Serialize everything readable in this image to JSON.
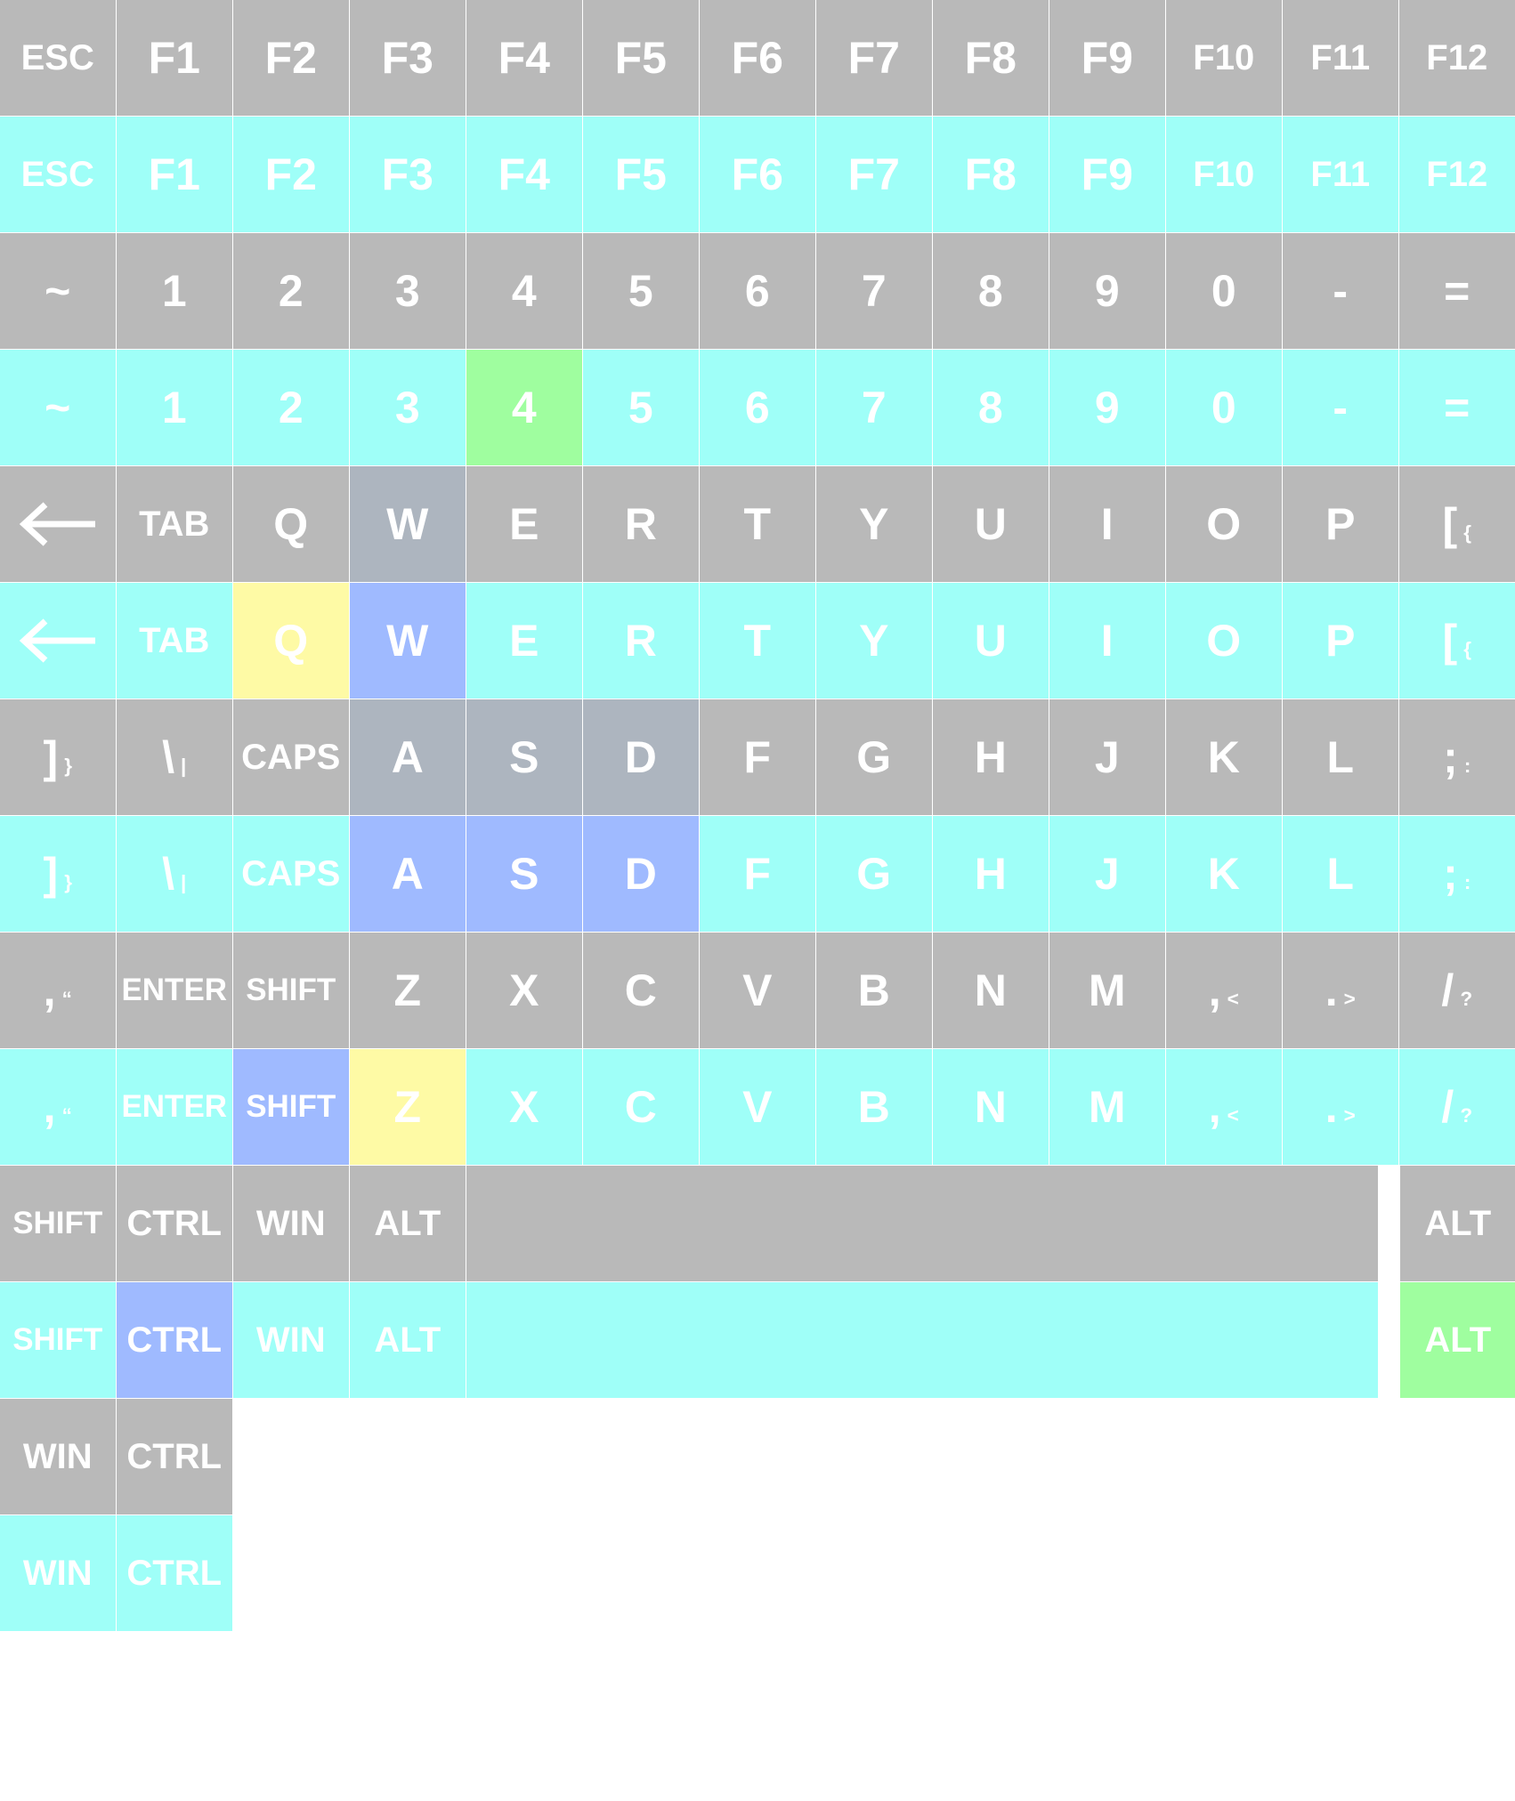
{
  "colors": {
    "grey": "#b9b9b9",
    "cyan": "#9ffff8",
    "green": "#9ffe9f",
    "yellow": "#fefaa5",
    "blue": "#9fbaff",
    "greyblue": "#adb5bf",
    "text": "#ffffff",
    "background": "#ffffff"
  },
  "rows": [
    {
      "color": "grey",
      "keys": [
        {
          "label": "ESC"
        },
        {
          "label": "F1"
        },
        {
          "label": "F2"
        },
        {
          "label": "F3"
        },
        {
          "label": "F4"
        },
        {
          "label": "F5"
        },
        {
          "label": "F6"
        },
        {
          "label": "F7"
        },
        {
          "label": "F8"
        },
        {
          "label": "F9"
        },
        {
          "label": "F10"
        },
        {
          "label": "F11"
        },
        {
          "label": "F12"
        }
      ]
    },
    {
      "color": "cyan",
      "keys": [
        {
          "label": "ESC"
        },
        {
          "label": "F1"
        },
        {
          "label": "F2"
        },
        {
          "label": "F3"
        },
        {
          "label": "F4"
        },
        {
          "label": "F5"
        },
        {
          "label": "F6"
        },
        {
          "label": "F7"
        },
        {
          "label": "F8"
        },
        {
          "label": "F9"
        },
        {
          "label": "F10"
        },
        {
          "label": "F11"
        },
        {
          "label": "F12"
        }
      ]
    },
    {
      "color": "grey",
      "keys": [
        {
          "label": "~"
        },
        {
          "label": "1"
        },
        {
          "label": "2"
        },
        {
          "label": "3"
        },
        {
          "label": "4"
        },
        {
          "label": "5"
        },
        {
          "label": "6"
        },
        {
          "label": "7"
        },
        {
          "label": "8"
        },
        {
          "label": "9"
        },
        {
          "label": "0"
        },
        {
          "label": "-"
        },
        {
          "label": "="
        }
      ]
    },
    {
      "color": "cyan",
      "keys": [
        {
          "label": "~"
        },
        {
          "label": "1"
        },
        {
          "label": "2"
        },
        {
          "label": "3"
        },
        {
          "label": "4",
          "color": "green"
        },
        {
          "label": "5"
        },
        {
          "label": "6"
        },
        {
          "label": "7"
        },
        {
          "label": "8"
        },
        {
          "label": "9"
        },
        {
          "label": "0"
        },
        {
          "label": "-"
        },
        {
          "label": "="
        }
      ]
    },
    {
      "color": "grey",
      "keys": [
        {
          "icon": "arrow-left-icon"
        },
        {
          "label": "TAB"
        },
        {
          "label": "Q"
        },
        {
          "label": "W",
          "color": "greyblue"
        },
        {
          "label": "E"
        },
        {
          "label": "R"
        },
        {
          "label": "T"
        },
        {
          "label": "Y"
        },
        {
          "label": "U"
        },
        {
          "label": "I"
        },
        {
          "label": "O"
        },
        {
          "label": "P"
        },
        {
          "label": "[",
          "sub": "{"
        }
      ]
    },
    {
      "color": "cyan",
      "keys": [
        {
          "icon": "arrow-left-icon"
        },
        {
          "label": "TAB"
        },
        {
          "label": "Q",
          "color": "yellow"
        },
        {
          "label": "W",
          "color": "blue"
        },
        {
          "label": "E"
        },
        {
          "label": "R"
        },
        {
          "label": "T"
        },
        {
          "label": "Y"
        },
        {
          "label": "U"
        },
        {
          "label": "I"
        },
        {
          "label": "O"
        },
        {
          "label": "P"
        },
        {
          "label": "[",
          "sub": "{"
        }
      ]
    },
    {
      "color": "grey",
      "keys": [
        {
          "label": "]",
          "sub": "}"
        },
        {
          "label": "\\",
          "sub": "|"
        },
        {
          "label": "CAPS"
        },
        {
          "label": "A",
          "color": "greyblue"
        },
        {
          "label": "S",
          "color": "greyblue"
        },
        {
          "label": "D",
          "color": "greyblue"
        },
        {
          "label": "F"
        },
        {
          "label": "G"
        },
        {
          "label": "H"
        },
        {
          "label": "J"
        },
        {
          "label": "K"
        },
        {
          "label": "L"
        },
        {
          "label": ";",
          "sub": ":"
        }
      ]
    },
    {
      "color": "cyan",
      "keys": [
        {
          "label": "]",
          "sub": "}"
        },
        {
          "label": "\\",
          "sub": "|"
        },
        {
          "label": "CAPS"
        },
        {
          "label": "A",
          "color": "blue"
        },
        {
          "label": "S",
          "color": "blue"
        },
        {
          "label": "D",
          "color": "blue"
        },
        {
          "label": "F"
        },
        {
          "label": "G"
        },
        {
          "label": "H"
        },
        {
          "label": "J"
        },
        {
          "label": "K"
        },
        {
          "label": "L"
        },
        {
          "label": ";",
          "sub": ":"
        }
      ]
    },
    {
      "color": "grey",
      "keys": [
        {
          "label": ",",
          "sub": "“"
        },
        {
          "label": "ENTER"
        },
        {
          "label": "SHIFT"
        },
        {
          "label": "Z"
        },
        {
          "label": "X"
        },
        {
          "label": "C"
        },
        {
          "label": "V"
        },
        {
          "label": "B"
        },
        {
          "label": "N"
        },
        {
          "label": "M"
        },
        {
          "label": ",",
          "sub": "<"
        },
        {
          "label": ".",
          "sub": ">"
        },
        {
          "label": "/",
          "sub": "?"
        }
      ]
    },
    {
      "color": "cyan",
      "keys": [
        {
          "label": ",",
          "sub": "“"
        },
        {
          "label": "ENTER"
        },
        {
          "label": "SHIFT",
          "color": "blue"
        },
        {
          "label": "Z",
          "color": "yellow"
        },
        {
          "label": "X"
        },
        {
          "label": "C"
        },
        {
          "label": "V"
        },
        {
          "label": "B"
        },
        {
          "label": "N"
        },
        {
          "label": "M"
        },
        {
          "label": ",",
          "sub": "<"
        },
        {
          "label": ".",
          "sub": ">"
        },
        {
          "label": "/",
          "sub": "?"
        }
      ]
    },
    {
      "color": "grey",
      "keys": [
        {
          "label": "SHIFT"
        },
        {
          "label": "CTRL"
        },
        {
          "label": "WIN"
        },
        {
          "label": "ALT"
        },
        {
          "label": "",
          "space": true
        },
        {
          "label": "ALT",
          "gap": true
        }
      ]
    },
    {
      "color": "cyan",
      "keys": [
        {
          "label": "SHIFT"
        },
        {
          "label": "CTRL",
          "color": "blue"
        },
        {
          "label": "WIN"
        },
        {
          "label": "ALT"
        },
        {
          "label": "",
          "space": true
        },
        {
          "label": "ALT",
          "color": "green",
          "gap": true
        }
      ]
    },
    {
      "color": "grey",
      "keys": [
        {
          "label": "WIN"
        },
        {
          "label": "CTRL"
        }
      ]
    },
    {
      "color": "cyan",
      "keys": [
        {
          "label": "WIN"
        },
        {
          "label": "CTRL"
        }
      ]
    }
  ]
}
